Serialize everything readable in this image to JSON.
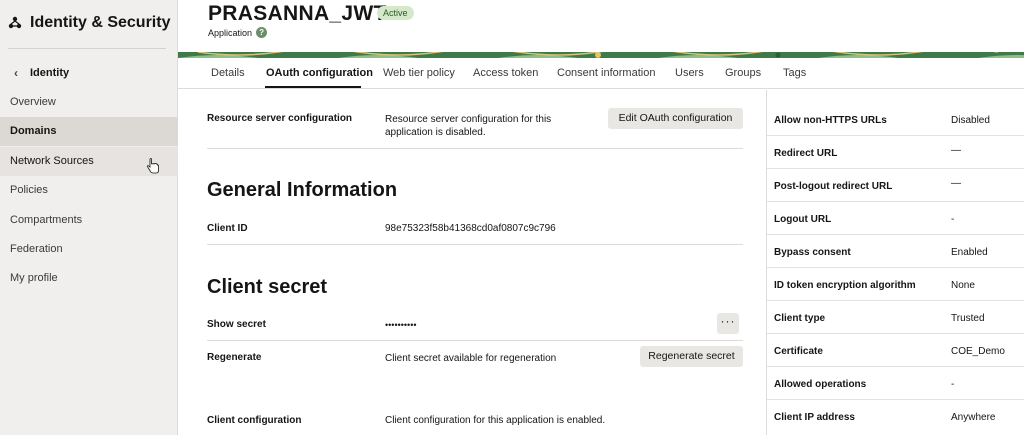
{
  "sidebar": {
    "title": "Identity & Security",
    "back_label": "Identity",
    "items": [
      {
        "label": "Overview"
      },
      {
        "label": "Domains"
      },
      {
        "label": "Network Sources"
      },
      {
        "label": "Policies"
      },
      {
        "label": "Compartments"
      },
      {
        "label": "Federation"
      },
      {
        "label": "My profile"
      }
    ]
  },
  "header": {
    "app_name": "PRASANNA_JWT",
    "status": "Active",
    "subtitle": "Application",
    "help_icon": "?"
  },
  "tabs": [
    {
      "label": "Details"
    },
    {
      "label": "OAuth configuration"
    },
    {
      "label": "Web tier policy"
    },
    {
      "label": "Access token"
    },
    {
      "label": "Consent information"
    },
    {
      "label": "Users"
    },
    {
      "label": "Groups"
    },
    {
      "label": "Tags"
    }
  ],
  "resource_server": {
    "label": "Resource server configuration",
    "value": "Resource server configuration for this application is disabled.",
    "button": "Edit OAuth configuration"
  },
  "general": {
    "heading": "General Information",
    "client_id_label": "Client ID",
    "client_id_value": "98e75323f58b41368cd0af0807c9c796"
  },
  "secret": {
    "heading": "Client secret",
    "show_label": "Show secret",
    "show_value": "••••••••••",
    "more_button": "···",
    "regen_label": "Regenerate",
    "regen_value": "Client secret available for regeneration",
    "regen_button": "Regenerate secret"
  },
  "client_config": {
    "label": "Client configuration",
    "value": "Client configuration for this application is enabled."
  },
  "right_panel": [
    {
      "label": "Allow non-HTTPS URLs",
      "value": "Disabled"
    },
    {
      "label": "Redirect URL",
      "value": "—"
    },
    {
      "label": "Post-logout redirect URL",
      "value": "—"
    },
    {
      "label": "Logout URL",
      "value": "-"
    },
    {
      "label": "Bypass consent",
      "value": "Enabled"
    },
    {
      "label": "ID token encryption algorithm",
      "value": "None"
    },
    {
      "label": "Client type",
      "value": "Trusted"
    },
    {
      "label": "Certificate",
      "value": "COE_Demo"
    },
    {
      "label": "Allowed operations",
      "value": "-"
    },
    {
      "label": "Client IP address",
      "value": "Anywhere"
    }
  ],
  "colors": {
    "active_badge_bg": "#d4e9cc",
    "active_badge_text": "#2a5c1c",
    "sidebar_bg": "#f1efed",
    "sidebar_active": "#dcd9d5",
    "banner_green": "#3f7a4a"
  }
}
